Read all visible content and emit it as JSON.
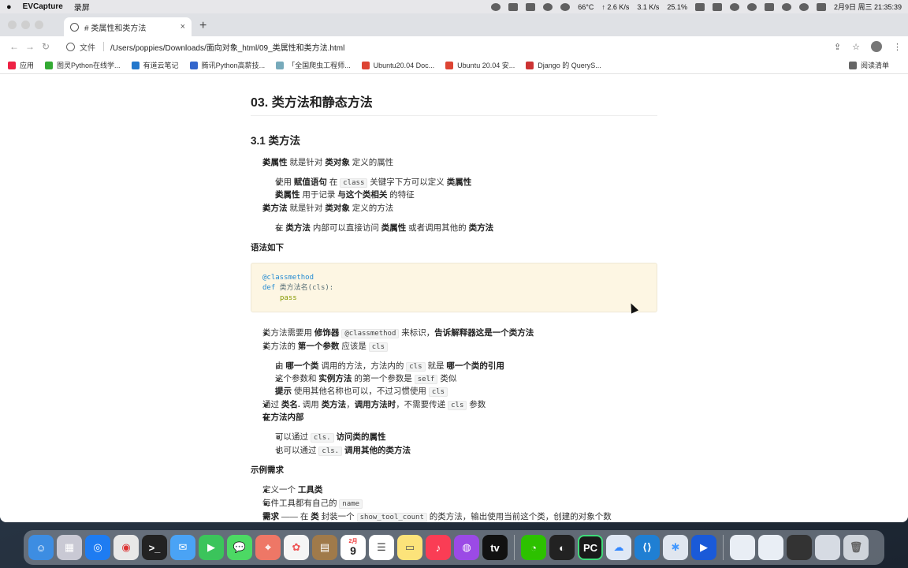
{
  "menubar": {
    "apple": "",
    "app_name": "EVCapture",
    "menu_item": "录屏",
    "temp": "66°C",
    "net_up": "↑ 2.6 K/s",
    "net_down": "3.1 K/s",
    "cpu": "25.1%",
    "datetime": "2月9日 周三  21:35:39"
  },
  "browser": {
    "tab_title": "# 类属性和类方法",
    "tab_close": "×",
    "new_tab": "+",
    "scheme_label": "文件",
    "url": "/Users/poppies/Downloads/面向对象_html/09_类属性和类方法.html",
    "bookmarks": [
      {
        "label": "应用",
        "color": "#e24"
      },
      {
        "label": "图灵Python在线学...",
        "color": "#3a3"
      },
      {
        "label": "有道云笔记",
        "color": "#27c"
      },
      {
        "label": "腾讯Python高薪技...",
        "color": "#36c"
      },
      {
        "label": "「全国爬虫工程师...",
        "color": "#7ab"
      },
      {
        "label": "Ubuntu20.04 Doc...",
        "color": "#d43"
      },
      {
        "label": "Ubuntu 20.04 安...",
        "color": "#d43"
      },
      {
        "label": "Django 的 QueryS...",
        "color": "#c33"
      }
    ],
    "reading_list": "阅读清单"
  },
  "article": {
    "h2": "03. 类方法和静态方法",
    "h3": "3.1 类方法",
    "l1": {
      "b1": "类属性",
      "t1": " 就是针对 ",
      "b2": "类对象",
      "t2": " 定义的属性"
    },
    "l2": {
      "t1": "使用 ",
      "b1": "赋值语句",
      "t2": " 在 ",
      "c1": "class",
      "t3": " 关键字下方可以定义 ",
      "b2": "类属性"
    },
    "l3": {
      "b1": "类属性",
      "t1": " 用于记录 ",
      "b2": "与这个类相关",
      "t2": " 的特征"
    },
    "l4": {
      "b1": "类方法",
      "t1": " 就是针对 ",
      "b2": "类对象",
      "t2": " 定义的方法"
    },
    "l5": {
      "t1": "在 ",
      "b1": "类方法",
      "t2": " 内部可以直接访问 ",
      "b2": "类属性",
      "t3": " 或者调用其他的 ",
      "b3": "类方法"
    },
    "syntax_title": "语法如下",
    "code": {
      "dec": "@classmethod",
      "def": "def",
      "sig": " 类方法名(cls):",
      "pass": "pass"
    },
    "l6": {
      "t1": "类方法需要用 ",
      "b1": "修饰器",
      "c1": "@classmethod",
      "t2": " 来标识，",
      "b2": "告诉解释器这是一个类方法"
    },
    "l7": {
      "t1": "类方法的 ",
      "b1": "第一个参数",
      "t2": " 应该是 ",
      "c1": "cls"
    },
    "l8": {
      "t1": "由 ",
      "b1": "哪一个类",
      "t2": " 调用的方法，方法内的 ",
      "c1": "cls",
      "t3": " 就是 ",
      "b2": "哪一个类的引用"
    },
    "l9": {
      "t1": "这个参数和 ",
      "b1": "实例方法",
      "t2": " 的第一个参数是 ",
      "c1": "self",
      "t3": " 类似"
    },
    "l10": {
      "b1": "提示",
      "t1": " 使用其他名称也可以，不过习惯使用 ",
      "c1": "cls"
    },
    "l11": {
      "t1": "通过 ",
      "b1": "类名.",
      "t2": " 调用 ",
      "b2": "类方法",
      "t3": "，",
      "b3": "调用方法时",
      "t4": "，不需要传递 ",
      "c1": "cls",
      "t5": " 参数"
    },
    "l12": {
      "b1": "在方法内部"
    },
    "l13": {
      "t1": "可以通过 ",
      "c1": "cls.",
      "b1": " 访问类的属性"
    },
    "l14": {
      "t1": "也可以通过 ",
      "c1": "cls.",
      "b1": " 调用其他的类方法"
    },
    "example_title": "示例需求",
    "l15": {
      "t1": "定义一个 ",
      "b1": "工具类"
    },
    "l16": {
      "t1": "每件工具都有自己的 ",
      "c1": "name"
    },
    "l17": {
      "b1": "需求",
      "t1": " —— 在 ",
      "b2": "类",
      "t2": " 封装一个 ",
      "c1": "show_tool_count",
      "t3": " 的类方法，输出使用当前这个类，创建的对象个数"
    }
  },
  "dock": {
    "calendar_month": "2月",
    "calendar_day": "9"
  }
}
